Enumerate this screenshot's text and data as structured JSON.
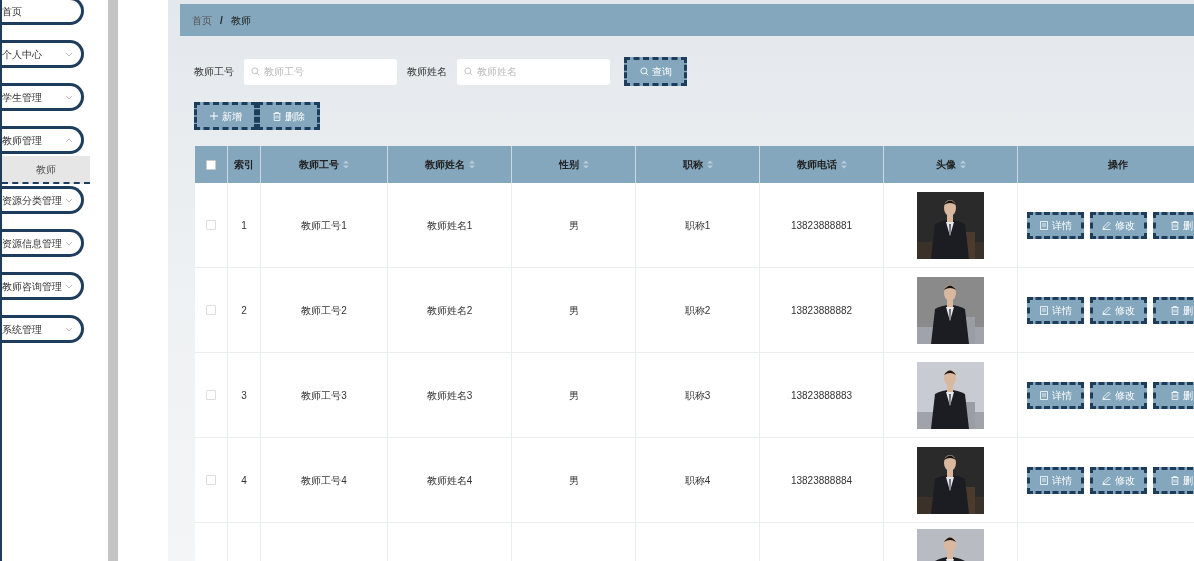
{
  "sidebar": {
    "items": [
      {
        "label": "首页",
        "expandable": false
      },
      {
        "label": "个人中心",
        "expandable": true,
        "expanded": false
      },
      {
        "label": "学生管理",
        "expandable": true,
        "expanded": false
      },
      {
        "label": "教师管理",
        "expandable": true,
        "expanded": true,
        "children": [
          {
            "label": "教师",
            "selected": true
          }
        ]
      },
      {
        "label": "资源分类管理",
        "expandable": true,
        "expanded": false
      },
      {
        "label": "资源信息管理",
        "expandable": true,
        "expanded": false
      },
      {
        "label": "教师咨询管理",
        "expandable": true,
        "expanded": false
      },
      {
        "label": "系统管理",
        "expandable": true,
        "expanded": false
      }
    ]
  },
  "breadcrumb": {
    "items": [
      "首页",
      "教师"
    ],
    "separator": "/"
  },
  "search": {
    "fields": [
      {
        "label": "教师工号",
        "placeholder": "教师工号"
      },
      {
        "label": "教师姓名",
        "placeholder": "教师姓名"
      }
    ],
    "button": "查询"
  },
  "actions": [
    {
      "kind": "add",
      "label": "新增"
    },
    {
      "kind": "delete",
      "label": "删除"
    }
  ],
  "table": {
    "all_checked": false,
    "columns": [
      {
        "label": "索引",
        "sortable": false
      },
      {
        "label": "教师工号",
        "sortable": true
      },
      {
        "label": "教师姓名",
        "sortable": true
      },
      {
        "label": "性别",
        "sortable": true
      },
      {
        "label": "职称",
        "sortable": true
      },
      {
        "label": "教师电话",
        "sortable": true
      },
      {
        "label": "头像",
        "sortable": true
      },
      {
        "label": "操作",
        "sortable": false
      }
    ],
    "rows": [
      {
        "checked": false,
        "cells": [
          "1",
          "教师工号1",
          "教师姓名1",
          "男",
          "职称1",
          "13823888881"
        ],
        "photo": {
          "kind": "picture"
        },
        "buttons": [
          {
            "kind": "detail",
            "label": "详情"
          },
          {
            "kind": "edit",
            "label": "修改"
          },
          {
            "kind": "delete",
            "label": "删"
          }
        ]
      },
      {
        "checked": false,
        "cells": [
          "2",
          "教师工号2",
          "教师姓名2",
          "男",
          "职称2",
          "13823888882"
        ],
        "photo": {
          "kind": "picture"
        },
        "buttons": [
          {
            "kind": "detail",
            "label": "详情"
          },
          {
            "kind": "edit",
            "label": "修改"
          },
          {
            "kind": "delete",
            "label": "删"
          }
        ]
      },
      {
        "checked": false,
        "cells": [
          "3",
          "教师工号3",
          "教师姓名3",
          "男",
          "职称3",
          "13823888883"
        ],
        "photo": {
          "kind": "picture"
        },
        "buttons": [
          {
            "kind": "detail",
            "label": "详情"
          },
          {
            "kind": "edit",
            "label": "修改"
          },
          {
            "kind": "delete",
            "label": "删"
          }
        ]
      },
      {
        "checked": false,
        "cells": [
          "4",
          "教师工号4",
          "教师姓名4",
          "男",
          "职称4",
          "13823888884"
        ],
        "photo": {
          "kind": "picture"
        },
        "buttons": [
          {
            "kind": "detail",
            "label": "详情"
          },
          {
            "kind": "edit",
            "label": "修改"
          },
          {
            "kind": "delete",
            "label": "删"
          }
        ]
      },
      {
        "photo": {
          "kind": "picture"
        }
      }
    ]
  }
}
